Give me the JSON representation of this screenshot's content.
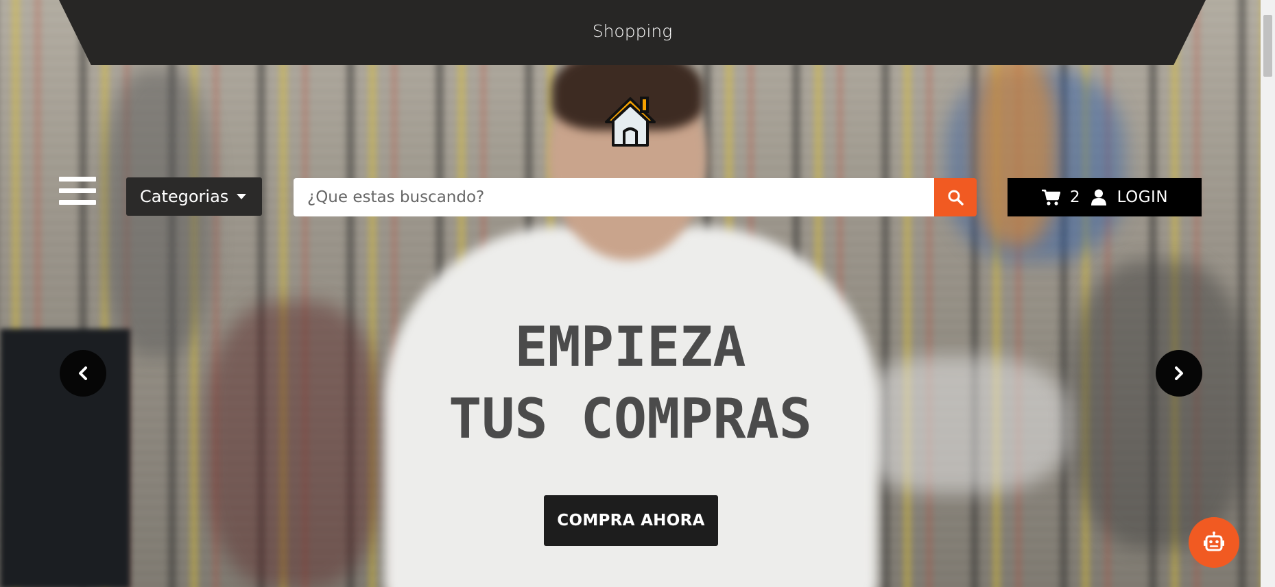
{
  "header": {
    "title": "Shopping"
  },
  "logo": {
    "icon": "house-icon",
    "colors": {
      "roof": "#f7a200",
      "walls": "#e6edf0",
      "outline": "#111111"
    }
  },
  "nav": {
    "menu_icon": "hamburger-icon",
    "categories_label": "Categorias",
    "search": {
      "placeholder": "¿Que estas buscando?",
      "value": "",
      "icon": "search-icon"
    },
    "cart": {
      "icon": "cart-icon",
      "count": "2"
    },
    "user": {
      "icon": "user-icon",
      "login_label": "LOGIN"
    }
  },
  "hero": {
    "line1": "EMPIEZA",
    "line2": "TUS COMPRAS",
    "cta_label": "COMPRA AHORA",
    "prev_icon": "chevron-left-icon",
    "next_icon": "chevron-right-icon"
  },
  "chatbot": {
    "icon": "robot-icon"
  },
  "colors": {
    "accent": "#f15a22",
    "dark": "#272625",
    "headline": "#4b4b4b"
  }
}
